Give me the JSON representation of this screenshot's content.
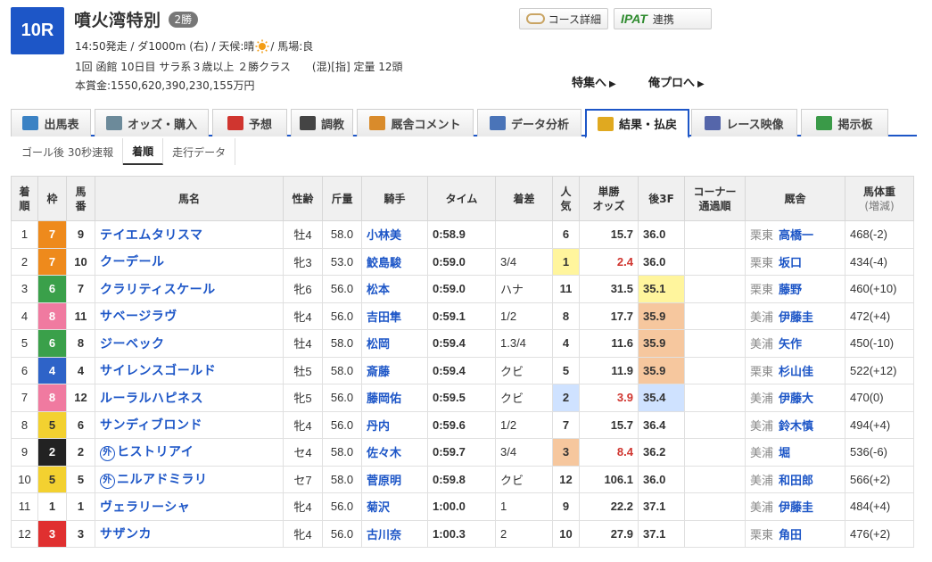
{
  "race": {
    "number": "10R",
    "name": "噴火湾特別",
    "grade": "2勝",
    "info1_a": "14:50発走 / ダ1000m (右) / 天候:晴",
    "info1_b": " / 馬場:良",
    "info2": "1回 函館 10日目 サラ系３歳以上 ２勝クラス　　(混)[指] 定量 12頭",
    "info3": "本賞金:1550,620,390,230,155万円"
  },
  "header_buttons": {
    "course": "コース詳細",
    "ipat_logo": "IPAT",
    "ipat": "連携"
  },
  "links": {
    "special": "特集へ",
    "pro": "俺プロへ"
  },
  "tabs": [
    {
      "label": "出馬表",
      "icon": "entry-table-icon",
      "color": "#3b82c4"
    },
    {
      "label": "オッズ・購入",
      "icon": "odds-icon",
      "color": "#6c8a9a"
    },
    {
      "label": "予想",
      "icon": "target-icon",
      "color": "#d0352f"
    },
    {
      "label": "調教",
      "icon": "stopwatch-icon",
      "color": "#444444"
    },
    {
      "label": "厩舎コメント",
      "icon": "stable-icon",
      "color": "#d98b2b"
    },
    {
      "label": "データ分析",
      "icon": "bar-chart-icon",
      "color": "#4a74b8"
    },
    {
      "label": "結果・払戻",
      "icon": "coins-icon",
      "color": "#e0a920"
    },
    {
      "label": "レース映像",
      "icon": "video-icon",
      "color": "#5566aa"
    },
    {
      "label": "掲示板",
      "icon": "chat-icon",
      "color": "#3a9a48"
    }
  ],
  "subtabs": [
    "ゴール後 30秒速報",
    "着順",
    "走行データ"
  ],
  "columns": {
    "rank": "着\n順",
    "waku": "枠",
    "umaban": "馬\n番",
    "horse": "馬名",
    "sexage": "性齢",
    "weight": "斤量",
    "jockey": "騎手",
    "time": "タイム",
    "margin": "着差",
    "pop": "人\n気",
    "odds": "単勝\nオッズ",
    "f3": "後3F",
    "corner": "コーナー\n通過順",
    "trainer": "厩舎",
    "bodyweight": "馬体重",
    "bodyweight_sub": "(増減)"
  },
  "waku_colors": {
    "1": {
      "bg": "#ffffff",
      "fg": "#333333"
    },
    "2": {
      "bg": "#222222",
      "fg": "#ffffff"
    },
    "3": {
      "bg": "#e03030",
      "fg": "#ffffff"
    },
    "4": {
      "bg": "#2e63c8",
      "fg": "#ffffff"
    },
    "5": {
      "bg": "#f3d130",
      "fg": "#333333"
    },
    "6": {
      "bg": "#3aa04a",
      "fg": "#ffffff"
    },
    "7": {
      "bg": "#ee8a1c",
      "fg": "#ffffff"
    },
    "8": {
      "bg": "#f07aa0",
      "fg": "#ffffff"
    }
  },
  "rows": [
    {
      "rank": "1",
      "waku": "7",
      "umaban": "9",
      "foreign": "",
      "horse": "テイエムタリスマ",
      "sexage": "牡4",
      "weight": "58.0",
      "jockey": "小林美",
      "time": "0:58.9",
      "margin": "",
      "pop": "6",
      "odds": "15.7",
      "f3": "36.0",
      "corner": "",
      "area": "栗東",
      "trainer": "高橋一",
      "bw": "468(-2)"
    },
    {
      "rank": "2",
      "waku": "7",
      "umaban": "10",
      "foreign": "",
      "horse": "クーデール",
      "sexage": "牝3",
      "weight": "53.0",
      "jockey": "鮫島駿",
      "time": "0:59.0",
      "margin": "3/4",
      "pop": "1",
      "odds": "2.4",
      "f3": "36.0",
      "corner": "",
      "area": "栗東",
      "trainer": "坂口",
      "bw": "434(-4)"
    },
    {
      "rank": "3",
      "waku": "6",
      "umaban": "7",
      "foreign": "",
      "horse": "クラリティスケール",
      "sexage": "牝6",
      "weight": "56.0",
      "jockey": "松本",
      "time": "0:59.0",
      "margin": "ハナ",
      "pop": "11",
      "odds": "31.5",
      "f3": "35.1",
      "corner": "",
      "area": "栗東",
      "trainer": "藤野",
      "bw": "460(+10)"
    },
    {
      "rank": "4",
      "waku": "8",
      "umaban": "11",
      "foreign": "",
      "horse": "サベージラヴ",
      "sexage": "牝4",
      "weight": "56.0",
      "jockey": "吉田隼",
      "time": "0:59.1",
      "margin": "1/2",
      "pop": "8",
      "odds": "17.7",
      "f3": "35.9",
      "corner": "",
      "area": "美浦",
      "trainer": "伊藤圭",
      "bw": "472(+4)"
    },
    {
      "rank": "5",
      "waku": "6",
      "umaban": "8",
      "foreign": "",
      "horse": "ジーベック",
      "sexage": "牡4",
      "weight": "58.0",
      "jockey": "松岡",
      "time": "0:59.4",
      "margin": "1.3/4",
      "pop": "4",
      "odds": "11.6",
      "f3": "35.9",
      "corner": "",
      "area": "美浦",
      "trainer": "矢作",
      "bw": "450(-10)"
    },
    {
      "rank": "6",
      "waku": "4",
      "umaban": "4",
      "foreign": "",
      "horse": "サイレンスゴールド",
      "sexage": "牡5",
      "weight": "58.0",
      "jockey": "斎藤",
      "time": "0:59.4",
      "margin": "クビ",
      "pop": "5",
      "odds": "11.9",
      "f3": "35.9",
      "corner": "",
      "area": "栗東",
      "trainer": "杉山佳",
      "bw": "522(+12)"
    },
    {
      "rank": "7",
      "waku": "8",
      "umaban": "12",
      "foreign": "",
      "horse": "ルーラルハピネス",
      "sexage": "牝5",
      "weight": "56.0",
      "jockey": "藤岡佑",
      "time": "0:59.5",
      "margin": "クビ",
      "pop": "2",
      "odds": "3.9",
      "f3": "35.4",
      "corner": "",
      "area": "美浦",
      "trainer": "伊藤大",
      "bw": "470(0)"
    },
    {
      "rank": "8",
      "waku": "5",
      "umaban": "6",
      "foreign": "",
      "horse": "サンディブロンド",
      "sexage": "牝4",
      "weight": "56.0",
      "jockey": "丹内",
      "time": "0:59.6",
      "margin": "1/2",
      "pop": "7",
      "odds": "15.7",
      "f3": "36.4",
      "corner": "",
      "area": "美浦",
      "trainer": "鈴木慎",
      "bw": "494(+4)"
    },
    {
      "rank": "9",
      "waku": "2",
      "umaban": "2",
      "foreign": "外",
      "horse": "ヒストリアイ",
      "sexage": "セ4",
      "weight": "58.0",
      "jockey": "佐々木",
      "time": "0:59.7",
      "margin": "3/4",
      "pop": "3",
      "odds": "8.4",
      "f3": "36.2",
      "corner": "",
      "area": "美浦",
      "trainer": "堀",
      "bw": "536(-6)"
    },
    {
      "rank": "10",
      "waku": "5",
      "umaban": "5",
      "foreign": "外",
      "horse": "ニルアドミラリ",
      "sexage": "セ7",
      "weight": "58.0",
      "jockey": "菅原明",
      "time": "0:59.8",
      "margin": "クビ",
      "pop": "12",
      "odds": "106.1",
      "f3": "36.0",
      "corner": "",
      "area": "美浦",
      "trainer": "和田郎",
      "bw": "566(+2)"
    },
    {
      "rank": "11",
      "waku": "1",
      "umaban": "1",
      "foreign": "",
      "horse": "ヴェラリーシャ",
      "sexage": "牝4",
      "weight": "56.0",
      "jockey": "菊沢",
      "time": "1:00.0",
      "margin": "1",
      "pop": "9",
      "odds": "22.2",
      "f3": "37.1",
      "corner": "",
      "area": "美浦",
      "trainer": "伊藤圭",
      "bw": "484(+4)"
    },
    {
      "rank": "12",
      "waku": "3",
      "umaban": "3",
      "foreign": "",
      "horse": "サザンカ",
      "sexage": "牝4",
      "weight": "56.0",
      "jockey": "古川奈",
      "time": "1:00.3",
      "margin": "2",
      "pop": "10",
      "odds": "27.9",
      "f3": "37.1",
      "corner": "",
      "area": "栗東",
      "trainer": "角田",
      "bw": "476(+2)"
    }
  ],
  "f3_highlight": {
    "35.1": "#fff59d",
    "35.4": "#cfe2ff",
    "35.9": "#f6c79e"
  }
}
